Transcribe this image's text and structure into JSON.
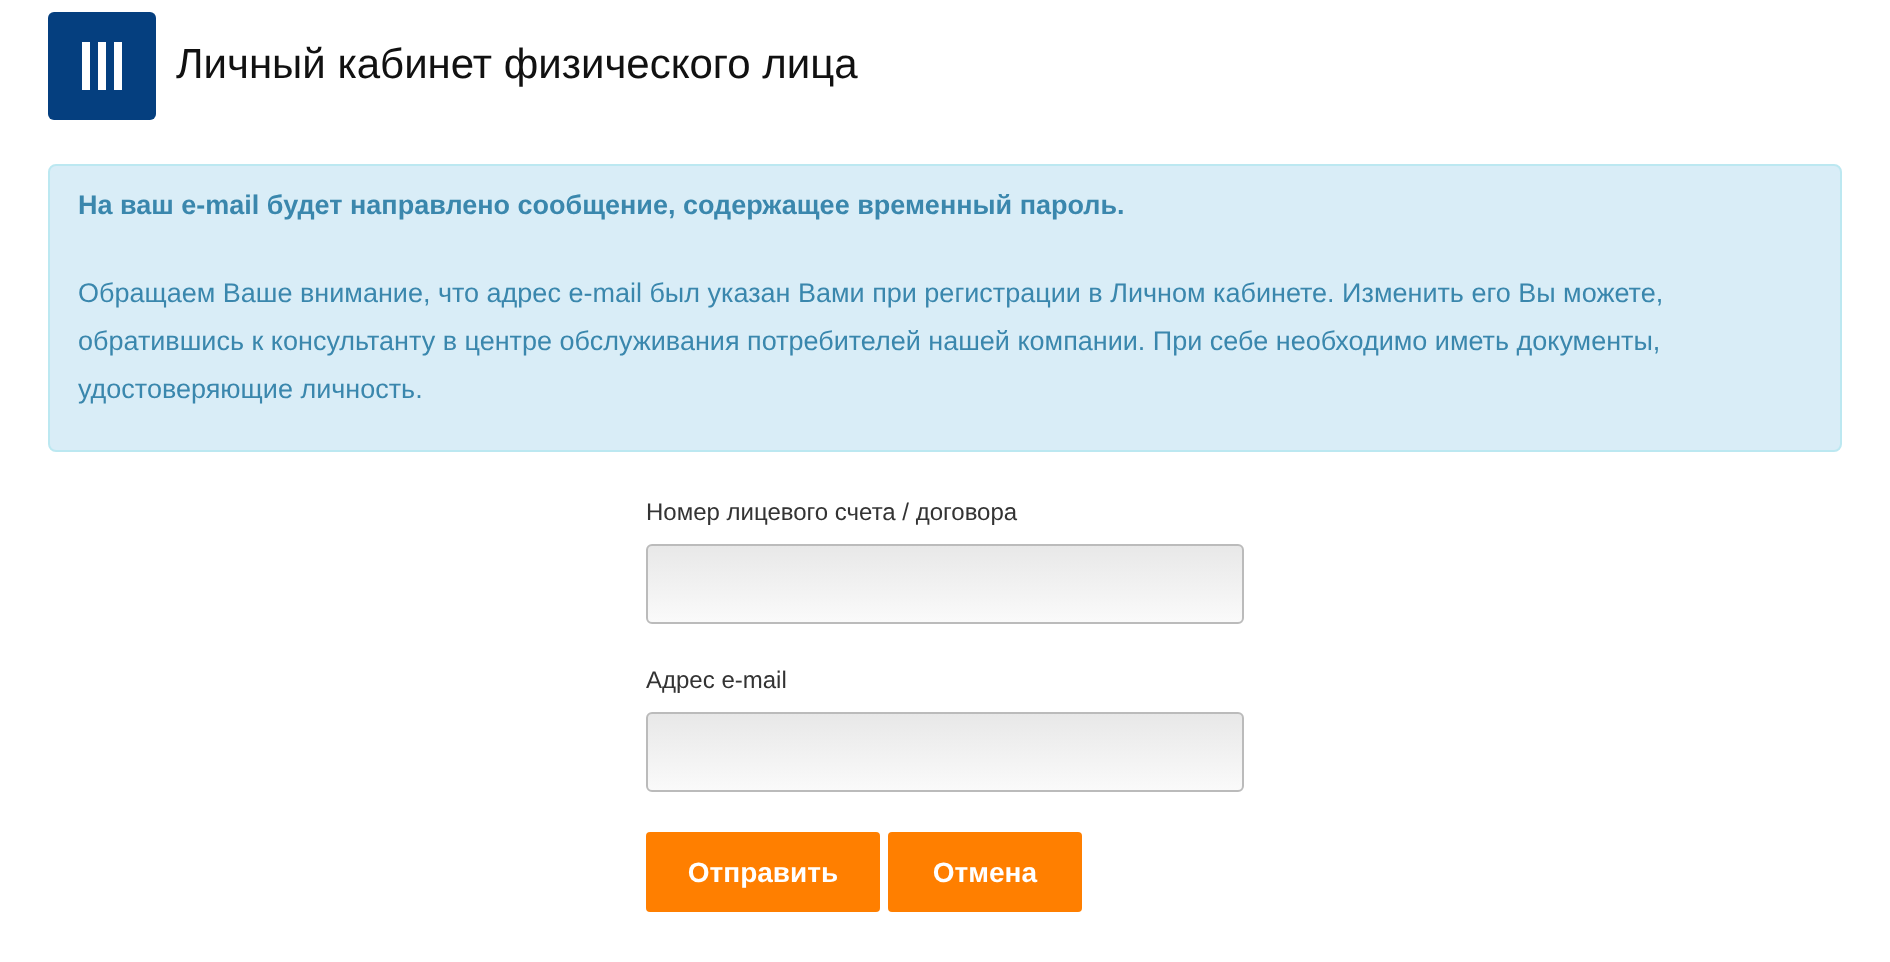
{
  "header": {
    "title": "Личный кабинет физического лица"
  },
  "notice": {
    "headline": "На ваш e-mail будет направлено сообщение, содержащее временный пароль.",
    "text": "Обращаем Ваше внимание, что адрес e-mail был указан Вами при регистрации в Личном кабинете. Изменить его Вы можете, обратившись к консультанту в центре обслуживания потребителей нашей компании. При себе необходимо иметь документы, удостоверяющие личность."
  },
  "form": {
    "fields": [
      {
        "label": "Номер лицевого счета / договора"
      },
      {
        "label": "Адрес e-mail"
      }
    ],
    "buttons": [
      {
        "label": "Отправить",
        "kind": "primary"
      },
      {
        "label": "Отмена",
        "kind": "cancel"
      }
    ]
  }
}
